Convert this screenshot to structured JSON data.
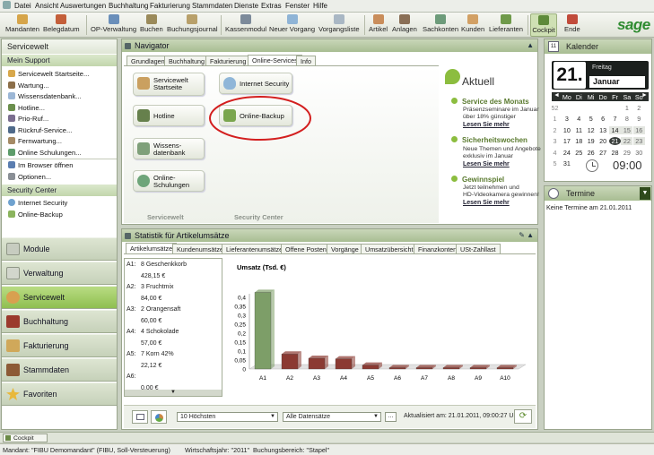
{
  "menu": [
    "Datei",
    "Ansicht",
    "Auswertungen",
    "Buchhaltung",
    "Fakturierung",
    "Stammdaten",
    "Dienste",
    "Extras",
    "Fenster",
    "Hilfe"
  ],
  "toolbar": [
    "Mandanten",
    "Belegdatum",
    "OP-Verwaltung",
    "Buchen",
    "Buchungsjournal",
    "Kassenmodul",
    "Neuer Vorgang",
    "Vorgangsliste",
    "Artikel",
    "Anlagen",
    "Sachkonten",
    "Kunden",
    "Lieferanten",
    "Cockpit",
    "Ende"
  ],
  "logo": "sage",
  "left": {
    "title": "Servicewelt",
    "support_head": "Mein Support",
    "support_items": [
      "Servicewelt Startseite...",
      "Wartung...",
      "Wissensdatenbank...",
      "Hotline...",
      "Prio-Ruf...",
      "Rückruf-Service...",
      "Fernwartung...",
      "Online Schulungen...",
      "Im Browser öffnen",
      "Optionen..."
    ],
    "security_head": "Security Center",
    "security_items": [
      "Internet Security",
      "Online-Backup"
    ],
    "nav": [
      "Module",
      "Verwaltung",
      "Servicewelt",
      "Buchhaltung",
      "Fakturierung",
      "Stammdaten",
      "Favoriten"
    ]
  },
  "navigator": {
    "title": "Navigator",
    "tabs": [
      "Grundlagen",
      "Buchhaltung",
      "Fakturierung",
      "Online-Services",
      "Info"
    ],
    "buttons": [
      "Servicewelt Startseite",
      "Hotline",
      "Wissens-datenbank",
      "Online-Schulungen"
    ],
    "security_buttons": [
      "Internet Security",
      "Online-Backup"
    ],
    "footer": [
      "Servicewelt",
      "Security Center"
    ],
    "aktuell": {
      "title": "Aktuell",
      "items": [
        {
          "head": "Service des Monats",
          "lines": [
            "Präsenzseminare im Januar",
            "über 18% günstiger"
          ],
          "more": "Lesen Sie mehr"
        },
        {
          "head": "Sicherheitswochen",
          "lines": [
            "Neue Themen und Angebote",
            "exklusiv im Januar"
          ],
          "more": "Lesen Sie mehr"
        },
        {
          "head": "Gewinnspiel",
          "lines": [
            "Jetzt teilnehmen und",
            "HD-Videokamera gewinnen!"
          ],
          "more": "Lesen Sie mehr"
        }
      ]
    }
  },
  "stat": {
    "title": "Statistik für Artikelumsätze",
    "tabs": [
      "Artikelumsätze",
      "Kundenumsätze",
      "Lieferantenumsätze",
      "Offene Posten",
      "Vorgänge",
      "Umsatzübersicht",
      "Finanzkonten",
      "USt-Zahllast"
    ],
    "list": [
      {
        "k": "A1:",
        "name": "8 Geschenkkorb",
        "val": "428,15 €"
      },
      {
        "k": "A2:",
        "name": "3 Fruchtmix",
        "val": "84,00 €"
      },
      {
        "k": "A3:",
        "name": "2 Orangensaft",
        "val": "60,00 €"
      },
      {
        "k": "A4:",
        "name": "4 Schokolade",
        "val": "57,00 €"
      },
      {
        "k": "A5:",
        "name": "7 Korn 42%",
        "val": "22,12 €"
      },
      {
        "k": "A6:",
        "name": "",
        "val": "0,00 €"
      }
    ],
    "combo1": "10 Höchsten",
    "combo2": "Alle Datensätze",
    "btn_dots": "...",
    "updated": "Aktualisiert am: 21.01.2011, 09:00:27 Uhr"
  },
  "chart_data": {
    "type": "bar",
    "title": "Umsatz (Tsd. €)",
    "categories": [
      "A1",
      "A2",
      "A3",
      "A4",
      "A5",
      "A6",
      "A7",
      "A8",
      "A9",
      "A10"
    ],
    "values": [
      0.428,
      0.084,
      0.06,
      0.057,
      0.022,
      0,
      0,
      0,
      0,
      0
    ],
    "yticks": [
      "0,4",
      "0,35",
      "0,3",
      "0,25",
      "0,2",
      "0,15",
      "0,1",
      "0,05",
      "0"
    ],
    "ylim": [
      0,
      0.4
    ],
    "colors": {
      "first": "#7d9e68",
      "rest": "#8b3a32"
    }
  },
  "calendar": {
    "title": "Kalender",
    "day": "21.",
    "weekday": "Freitag",
    "month": "Januar",
    "headers": [
      "Mo",
      "Di",
      "Mi",
      "Do",
      "Fr",
      "Sa",
      "So"
    ],
    "weeks": [
      [
        "52",
        "",
        "",
        "",
        "",
        "",
        "1",
        "2"
      ],
      [
        "1",
        "3",
        "4",
        "5",
        "6",
        "7",
        "8",
        "9"
      ],
      [
        "2",
        "10",
        "11",
        "12",
        "13",
        "14",
        "15",
        "16"
      ],
      [
        "3",
        "17",
        "18",
        "19",
        "20",
        "21",
        "22",
        "23"
      ],
      [
        "4",
        "24",
        "25",
        "26",
        "27",
        "28",
        "29",
        "30"
      ],
      [
        "5",
        "31",
        "",
        "",
        "",
        "",
        "",
        ""
      ]
    ],
    "time": "09:00"
  },
  "termine": {
    "title": "Termine",
    "text": "Keine Termine am 21.01.2011"
  },
  "cockpit": "Cockpit",
  "status": [
    "Mandant: \"FIBU Demomandant\" (FIBU, Soll-Versteuerung)",
    "Wirtschaftsjahr: \"2011\"",
    "Buchungsbereich: \"Stapel\""
  ]
}
